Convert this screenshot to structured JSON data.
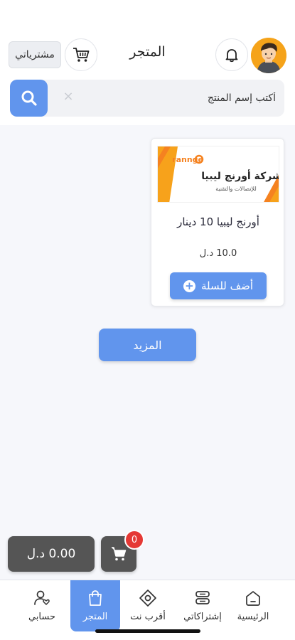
{
  "header": {
    "title": "المتجر",
    "purchases_label": "مشترياتي"
  },
  "search": {
    "placeholder": "أكتب إسم المنتج",
    "clear_symbol": "×"
  },
  "products": [
    {
      "name": "أورنج ليبيا 10 دينار",
      "price": "10.0 د.ل",
      "add_label": "أضف للسلة",
      "image": {
        "brand": "rannge",
        "company": "شركة أورنج ليبيا",
        "tagline": "للإتصالات والتقنية"
      }
    }
  ],
  "more_label": "المزيد",
  "cart": {
    "total": "0.00 د.ل",
    "count": "0"
  },
  "nav": {
    "items": [
      {
        "label": "الرئيسية",
        "icon": "home-icon"
      },
      {
        "label": "إشتراكاتي",
        "icon": "subscriptions-icon"
      },
      {
        "label": "أقرب نت",
        "icon": "location-diamond-icon"
      },
      {
        "label": "المتجر",
        "icon": "shopping-bag-icon",
        "active": true
      },
      {
        "label": "حسابي",
        "icon": "account-heart-icon"
      }
    ]
  },
  "colors": {
    "accent": "#6195ed",
    "dark": "#555555",
    "badge": "#e53935",
    "orange": "#f58220"
  }
}
